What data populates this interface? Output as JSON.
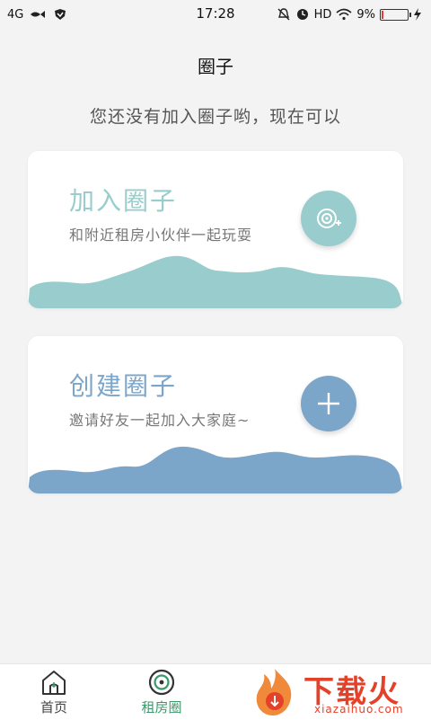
{
  "status_bar": {
    "network": "4G",
    "time": "17:28",
    "hd": "HD",
    "battery_percent": "9%",
    "battery_level": 0.09
  },
  "header": {
    "title": "圈子"
  },
  "intro": {
    "text": "您还没有加入圈子哟，现在可以"
  },
  "cards": {
    "join": {
      "title": "加入圈子",
      "description": "和附近租房小伙伴一起玩耍",
      "button_icon": "join-circle-icon",
      "color": "#99cccc"
    },
    "create": {
      "title": "创建圈子",
      "description": "邀请好友一起加入大家庭~",
      "button_icon": "plus-icon",
      "color": "#7ba5c9"
    }
  },
  "bottom_nav": {
    "items": [
      {
        "label": "首页",
        "icon": "home-icon"
      },
      {
        "label": "租房圈",
        "icon": "circle-icon",
        "active": true
      }
    ]
  },
  "watermark": {
    "title": "下载火",
    "url": "xiazaihuo.com"
  }
}
